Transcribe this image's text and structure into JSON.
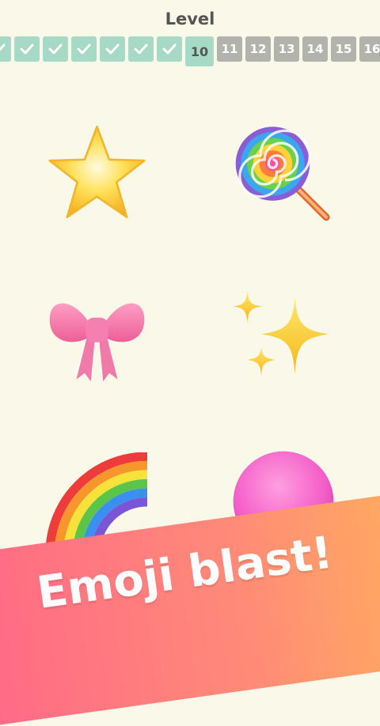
{
  "header": {
    "title": "Level"
  },
  "levels": {
    "completed_count": 6,
    "current": "10",
    "upcoming": [
      "11",
      "12",
      "13",
      "14",
      "15",
      "16"
    ]
  },
  "board": {
    "items": [
      {
        "name": "star-emoji"
      },
      {
        "name": "lollipop-emoji"
      },
      {
        "name": "ribbon-bow-emoji"
      },
      {
        "name": "sparkles-emoji"
      },
      {
        "name": "rainbow-emoji"
      },
      {
        "name": "pink-circle-emoji"
      }
    ]
  },
  "banner": {
    "text": "Emoji blast!"
  },
  "colors": {
    "background": "#faf8e8",
    "completed": "#a7d9c7",
    "locked": "#b3b3ae",
    "banner_start": "#ff6a86",
    "banner_end": "#ffb35a"
  }
}
